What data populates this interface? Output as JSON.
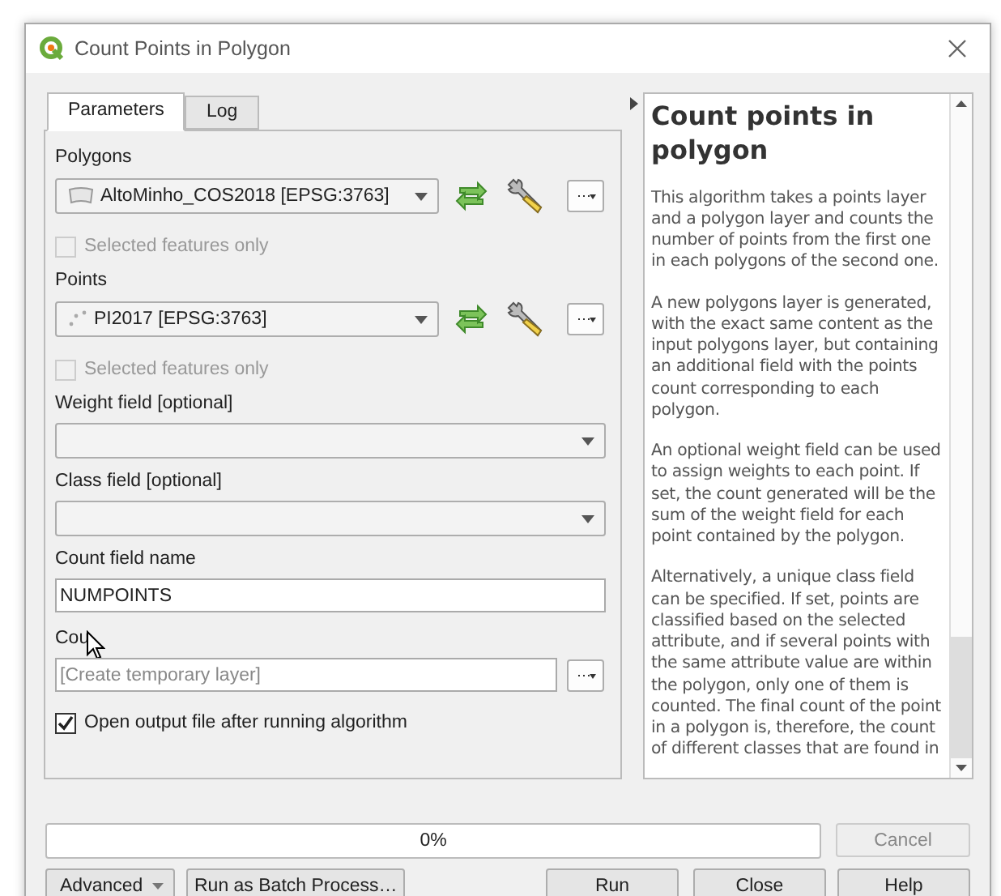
{
  "window": {
    "title": "Count Points in Polygon"
  },
  "tabs": [
    {
      "label": "Parameters",
      "selected": true
    },
    {
      "label": "Log",
      "selected": false
    }
  ],
  "parameters": [
    {
      "kind": "polygon_layer",
      "label": "Polygons",
      "value": "AltoMinho_COS2018 [EPSG:3763]"
    },
    {
      "kind": "checkbox",
      "label": "Selected features only",
      "checked": false,
      "disabled": true
    },
    {
      "kind": "point_layer",
      "label": "Points",
      "value": "PI2017 [EPSG:3763]"
    },
    {
      "kind": "checkbox",
      "label": "Selected features only",
      "checked": false,
      "disabled": true
    },
    {
      "kind": "select",
      "label": "Weight field [optional]"
    },
    {
      "kind": "select",
      "label": "Class field [optional]"
    },
    {
      "kind": "text",
      "label": "Count field name",
      "value": "NUMPOINTS"
    },
    {
      "kind": "output",
      "label": "Cou",
      "placeholder": "[Create temporary layer]"
    },
    {
      "kind": "checkbox",
      "label": "Open output file after running algorithm",
      "checked": true,
      "disabled": false
    }
  ],
  "help": {
    "title": "Count points in polygon",
    "paragraphs": [
      "This algorithm takes a points layer and a polygon layer and counts the number of points from the first one in each polygons of the second one.",
      "A new polygons layer is generated, with the exact same content as the input polygons layer, but containing an additional field with the points count corresponding to each polygon.",
      "An optional weight field can be used to assign weights to each point. If set, the count generated will be the sum of the weight field for each point contained by the polygon.",
      "Alternatively, a unique class field can be specified. If set, points are classified based on the selected attribute, and if several points with the same attribute value are within the polygon, only one of them is counted. The final count of the point in a polygon is, therefore, the count of different classes that are found in"
    ]
  },
  "progress": {
    "level": 0,
    "text": "0%"
  },
  "cancel_button": {
    "label": "Cancel",
    "disabled": true
  },
  "buttons": [
    {
      "label": "Advanced",
      "kind": "menu"
    },
    {
      "label": "Run as Batch Process…",
      "kind": "plain"
    },
    {
      "label": "Run",
      "kind": "plain"
    },
    {
      "label": "Close",
      "kind": "plain"
    },
    {
      "label": "Help",
      "kind": "plain"
    }
  ]
}
